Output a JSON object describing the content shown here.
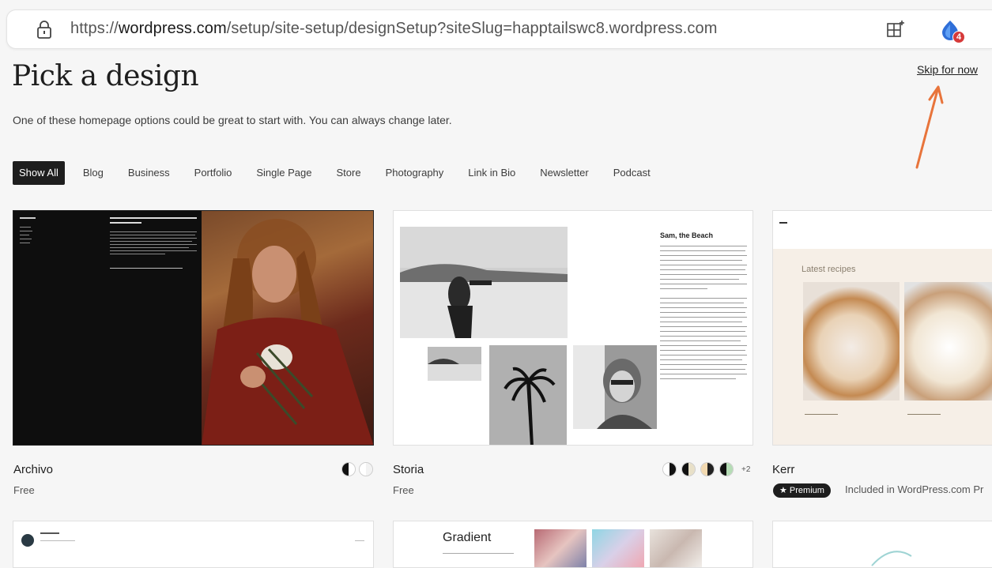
{
  "browser": {
    "url_prefix": "https://",
    "url_host": "wordpress.com",
    "url_path": "/setup/site-setup/designSetup?siteSlug=happtailswc8.wordpress.com",
    "extension_badge": "4"
  },
  "header": {
    "title": "Pick a design",
    "skip_label": "Skip for now",
    "subtitle": "One of these homepage options could be great to start with. You can always change later."
  },
  "filters": [
    "Show All",
    "Blog",
    "Business",
    "Portfolio",
    "Single Page",
    "Store",
    "Photography",
    "Link in Bio",
    "Newsletter",
    "Podcast"
  ],
  "designs": [
    {
      "name": "Archivo",
      "price": "Free"
    },
    {
      "name": "Storia",
      "price": "Free",
      "extra_styles": "+2",
      "preview_title": "Sam, the Beach"
    },
    {
      "name": "Kerr",
      "badge": "★ Premium",
      "included": "Included in WordPress.com Pr",
      "preview_heading": "Latest recipes"
    }
  ],
  "bottom_row": {
    "gradient_title": "Gradient"
  },
  "colors": {
    "accent": "#1e1e1e",
    "arrow": "#e8743b",
    "badge": "#d63a3a"
  }
}
